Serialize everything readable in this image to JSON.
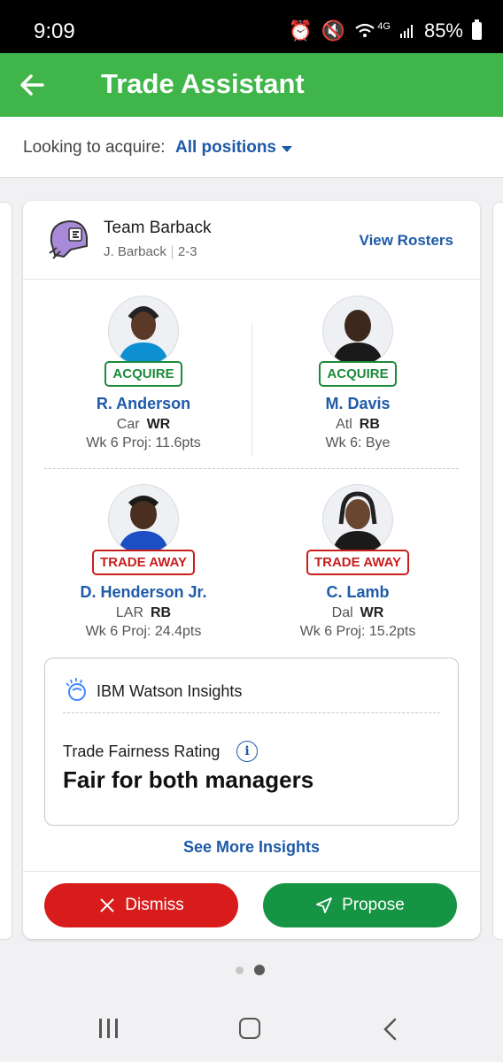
{
  "status": {
    "time": "9:09",
    "battery": "85%",
    "network": "4G"
  },
  "appbar": {
    "title": "Trade Assistant"
  },
  "filter": {
    "label": "Looking to acquire:",
    "value": "All positions"
  },
  "team": {
    "name": "Team Barback",
    "manager": "J. Barback",
    "record": "2-3",
    "view_rosters": "View Rosters"
  },
  "players": [
    {
      "tag": "ACQUIRE",
      "name": "R. Anderson",
      "team": "Car",
      "pos": "WR",
      "proj": "Wk 6 Proj: 11.6pts",
      "skin": "#5a3a26",
      "jersey": "#0d8fd1"
    },
    {
      "tag": "ACQUIRE",
      "name": "M. Davis",
      "team": "Atl",
      "pos": "RB",
      "proj": "Wk 6: Bye",
      "skin": "#3d281d",
      "jersey": "#1a1a1a"
    },
    {
      "tag": "TRADE AWAY",
      "name": "D. Henderson Jr.",
      "team": "LAR",
      "pos": "RB",
      "proj": "Wk 6 Proj: 24.4pts",
      "skin": "#4a2f20",
      "jersey": "#1d4fc4"
    },
    {
      "tag": "TRADE AWAY",
      "name": "C. Lamb",
      "team": "Dal",
      "pos": "WR",
      "proj": "Wk 6 Proj: 15.2pts",
      "skin": "#6a4631",
      "jersey": "#1a1a1a"
    }
  ],
  "insights": {
    "title": "IBM Watson Insights",
    "fairness_label": "Trade Fairness Rating",
    "fairness_value": "Fair for both managers",
    "see_more": "See More Insights"
  },
  "actions": {
    "dismiss": "Dismiss",
    "propose": "Propose"
  },
  "pager": {
    "count": 2,
    "active": 2
  }
}
